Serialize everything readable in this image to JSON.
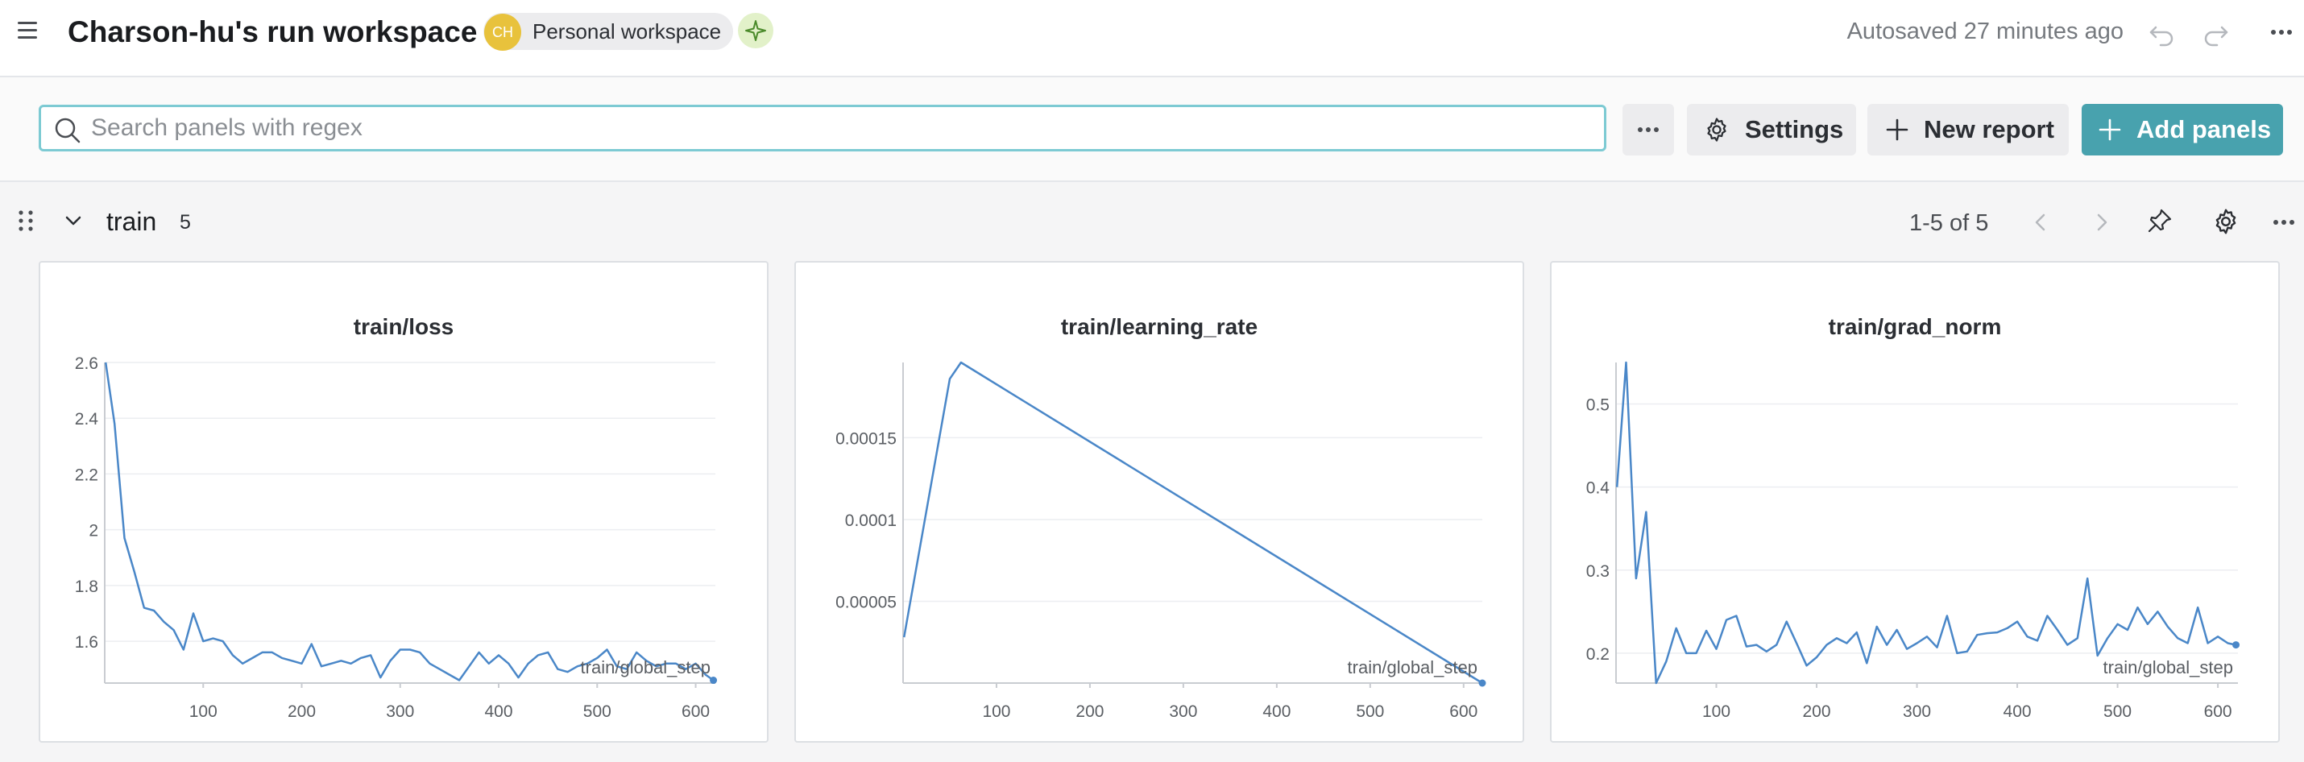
{
  "header": {
    "title": "Charson-hu's run workspace",
    "avatar_initials": "CH",
    "workspace_label": "Personal workspace",
    "autosaved": "Autosaved 27 minutes ago"
  },
  "toolbar": {
    "search_placeholder": "Search panels with regex",
    "settings_label": "Settings",
    "new_report_label": "New report",
    "add_panels_label": "Add panels",
    "accent_color": "#48a2ae"
  },
  "section": {
    "name": "train",
    "count": "5",
    "pagination": "1-5 of 5"
  },
  "chart_data": [
    {
      "type": "line",
      "title": "train/loss",
      "xlabel": "train/global_step",
      "ylabel": "",
      "color": "#4a87c8",
      "xlim": [
        0,
        620
      ],
      "ylim": [
        1.45,
        2.6
      ],
      "xticks": [
        100,
        200,
        300,
        400,
        500,
        600
      ],
      "yticks": [
        1.6,
        1.8,
        2,
        2.2,
        2.4,
        2.6
      ],
      "ytick_labels": [
        "1.6",
        "1.8",
        "2",
        "2.2",
        "2.4",
        "2.6"
      ],
      "x": [
        1,
        10,
        20,
        30,
        40,
        50,
        60,
        70,
        80,
        90,
        100,
        110,
        120,
        130,
        140,
        150,
        160,
        170,
        180,
        190,
        200,
        210,
        220,
        230,
        240,
        250,
        260,
        270,
        280,
        290,
        300,
        310,
        320,
        330,
        340,
        350,
        360,
        370,
        380,
        390,
        400,
        410,
        420,
        430,
        440,
        450,
        460,
        470,
        480,
        490,
        500,
        510,
        520,
        530,
        540,
        550,
        560,
        570,
        580,
        590,
        600,
        610,
        618
      ],
      "y": [
        2.6,
        2.38,
        1.97,
        1.85,
        1.72,
        1.71,
        1.67,
        1.64,
        1.57,
        1.7,
        1.6,
        1.61,
        1.6,
        1.55,
        1.52,
        1.54,
        1.56,
        1.56,
        1.54,
        1.53,
        1.52,
        1.59,
        1.51,
        1.52,
        1.53,
        1.52,
        1.54,
        1.55,
        1.47,
        1.53,
        1.57,
        1.57,
        1.56,
        1.52,
        1.5,
        1.48,
        1.46,
        1.51,
        1.56,
        1.52,
        1.55,
        1.52,
        1.47,
        1.52,
        1.55,
        1.56,
        1.5,
        1.49,
        1.51,
        1.52,
        1.54,
        1.57,
        1.51,
        1.5,
        1.56,
        1.53,
        1.51,
        1.52,
        1.52,
        1.5,
        1.52,
        1.48,
        1.46
      ]
    },
    {
      "type": "line",
      "title": "train/learning_rate",
      "xlabel": "train/global_step",
      "ylabel": "",
      "color": "#4a87c8",
      "xlim": [
        0,
        620
      ],
      "ylim": [
        0,
        0.000196
      ],
      "xticks": [
        100,
        200,
        300,
        400,
        500,
        600
      ],
      "yticks": [
        5e-05,
        0.0001,
        0.00015
      ],
      "ytick_labels": [
        "0.00005",
        "0.0001",
        "0.00015"
      ],
      "x": [
        1,
        50,
        62,
        620
      ],
      "y": [
        2.8e-05,
        0.000186,
        0.000196,
        0.0
      ]
    },
    {
      "type": "line",
      "title": "train/grad_norm",
      "xlabel": "train/global_step",
      "ylabel": "",
      "color": "#4a87c8",
      "xlim": [
        0,
        620
      ],
      "ylim": [
        0.164,
        0.55
      ],
      "xticks": [
        100,
        200,
        300,
        400,
        500,
        600
      ],
      "yticks": [
        0.2,
        0.3,
        0.4,
        0.5
      ],
      "ytick_labels": [
        "0.2",
        "0.3",
        "0.4",
        "0.5"
      ],
      "x": [
        1,
        10,
        20,
        30,
        40,
        50,
        60,
        70,
        80,
        90,
        100,
        110,
        120,
        130,
        140,
        150,
        160,
        170,
        180,
        190,
        200,
        210,
        220,
        230,
        240,
        250,
        260,
        270,
        280,
        290,
        300,
        310,
        320,
        330,
        340,
        350,
        360,
        370,
        380,
        390,
        400,
        410,
        420,
        430,
        440,
        450,
        460,
        470,
        480,
        490,
        500,
        510,
        520,
        530,
        540,
        550,
        560,
        570,
        580,
        590,
        600,
        610,
        618
      ],
      "y": [
        0.4,
        0.55,
        0.29,
        0.37,
        0.164,
        0.19,
        0.23,
        0.2,
        0.2,
        0.227,
        0.205,
        0.24,
        0.245,
        0.208,
        0.21,
        0.202,
        0.21,
        0.238,
        0.212,
        0.185,
        0.195,
        0.21,
        0.218,
        0.212,
        0.225,
        0.188,
        0.232,
        0.21,
        0.228,
        0.205,
        0.212,
        0.22,
        0.207,
        0.245,
        0.2,
        0.202,
        0.222,
        0.224,
        0.225,
        0.23,
        0.238,
        0.22,
        0.215,
        0.245,
        0.228,
        0.21,
        0.218,
        0.29,
        0.197,
        0.218,
        0.235,
        0.228,
        0.255,
        0.235,
        0.25,
        0.232,
        0.218,
        0.212,
        0.255,
        0.212,
        0.22,
        0.212,
        0.21
      ]
    }
  ]
}
